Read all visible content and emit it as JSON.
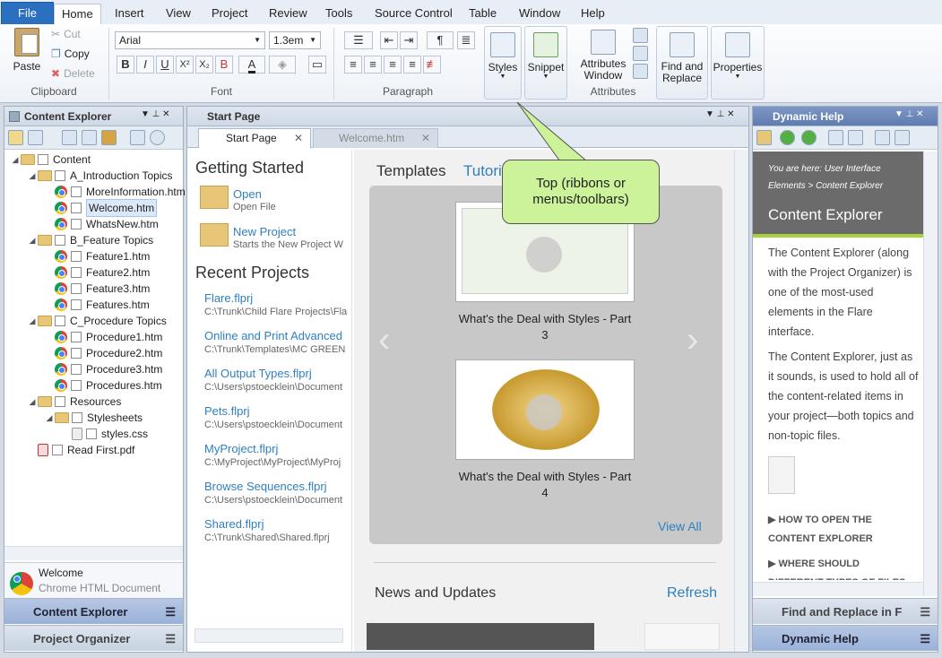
{
  "menu": {
    "file": "File",
    "tabs": [
      "Home",
      "Insert",
      "View",
      "Project",
      "Review",
      "Tools",
      "Source Control",
      "Table",
      "Window",
      "Help"
    ]
  },
  "ribbon": {
    "clipboard": {
      "label": "Clipboard",
      "paste": "Paste",
      "cut": "Cut",
      "copy": "Copy",
      "delete": "Delete"
    },
    "font": {
      "label": "Font",
      "family": "Arial",
      "size": "1.3em",
      "buttons": [
        "B",
        "I",
        "U",
        "X²",
        "X₂",
        "B"
      ]
    },
    "paragraph": {
      "label": "Paragraph"
    },
    "styles": "Styles",
    "snippet": "Snippet",
    "attributes": {
      "label": "Attributes",
      "window": "Attributes Window"
    },
    "find_replace": "Find and Replace",
    "properties": "Properties"
  },
  "content_explorer": {
    "title": "Content Explorer",
    "tree": [
      {
        "label": "Content",
        "type": "folder",
        "level": 0
      },
      {
        "label": "A_Introduction Topics",
        "type": "folder",
        "level": 1
      },
      {
        "label": "MoreInformation.htm",
        "type": "file",
        "level": 2
      },
      {
        "label": "Welcome.htm",
        "type": "file",
        "level": 2,
        "selected": true
      },
      {
        "label": "WhatsNew.htm",
        "type": "file",
        "level": 2
      },
      {
        "label": "B_Feature Topics",
        "type": "folder",
        "level": 1
      },
      {
        "label": "Feature1.htm",
        "type": "file",
        "level": 2
      },
      {
        "label": "Feature2.htm",
        "type": "file",
        "level": 2
      },
      {
        "label": "Feature3.htm",
        "type": "file",
        "level": 2
      },
      {
        "label": "Features.htm",
        "type": "file",
        "level": 2
      },
      {
        "label": "C_Procedure Topics",
        "type": "folder",
        "level": 1
      },
      {
        "label": "Procedure1.htm",
        "type": "file",
        "level": 2
      },
      {
        "label": "Procedure2.htm",
        "type": "file",
        "level": 2
      },
      {
        "label": "Procedure3.htm",
        "type": "file",
        "level": 2
      },
      {
        "label": "Procedures.htm",
        "type": "file",
        "level": 2
      },
      {
        "label": "Resources",
        "type": "folder",
        "level": 1
      },
      {
        "label": "Stylesheets",
        "type": "folder",
        "level": 2
      },
      {
        "label": "styles.css",
        "type": "css",
        "level": 3
      },
      {
        "label": "Read First.pdf",
        "type": "pdf",
        "level": 1
      }
    ],
    "preview_name": "Welcome",
    "preview_type": "Chrome HTML Document",
    "nav_tabs": [
      "Content Explorer",
      "Project Organizer"
    ]
  },
  "start_page": {
    "title": "Start Page",
    "tabs": [
      "Start Page",
      "Welcome.htm"
    ],
    "getting_started": "Getting Started",
    "open": "Open",
    "open_sub": "Open File",
    "new_project": "New Project",
    "new_project_sub": "Starts the New Project W",
    "recent_projects": "Recent Projects",
    "projects": [
      {
        "name": "Flare.flprj",
        "path": "C:\\Trunk\\Child Flare Projects\\Fla"
      },
      {
        "name": "Online and Print Advanced",
        "path": "C:\\Trunk\\Templates\\MC GREEN"
      },
      {
        "name": "All Output Types.flprj",
        "path": "C:\\Users\\pstoecklein\\Document"
      },
      {
        "name": "Pets.flprj",
        "path": "C:\\Users\\pstoecklein\\Document"
      },
      {
        "name": "MyProject.flprj",
        "path": "C:\\MyProject\\MyProject\\MyProj"
      },
      {
        "name": "Browse Sequences.flprj",
        "path": "C:\\Users\\pstoecklein\\Document"
      },
      {
        "name": "Shared.flprj",
        "path": "C:\\Trunk\\Shared\\Shared.flprj"
      }
    ],
    "templates": "Templates",
    "tutorials": "Tutori",
    "video1": "What's the Deal with Styles - Part 3",
    "video2": "What's the Deal with Styles - Part 4",
    "view_all": "View All",
    "news": "News and Updates",
    "refresh": "Refresh"
  },
  "callout": "Top (ribbons or menus/toolbars)",
  "dynamic_help": {
    "title": "Dynamic Help",
    "breadcrumb": "You are here: User Interface Elements > Content Explorer",
    "heading": "Content Explorer",
    "p1": "The Content Explorer (along with the Project Organizer) is one of the most-used elements in the Flare interface.",
    "p2": "The Content Explorer, just as it sounds, is used to hold all of the content-related items in your project—both topics and non-topic files.",
    "link1": "HOW TO OPEN THE CONTENT EXPLORER",
    "link2": "WHERE SHOULD DIFFERENT TYPES OF FILES",
    "nav_tabs": [
      "Find and Replace in F",
      "Dynamic Help"
    ]
  }
}
